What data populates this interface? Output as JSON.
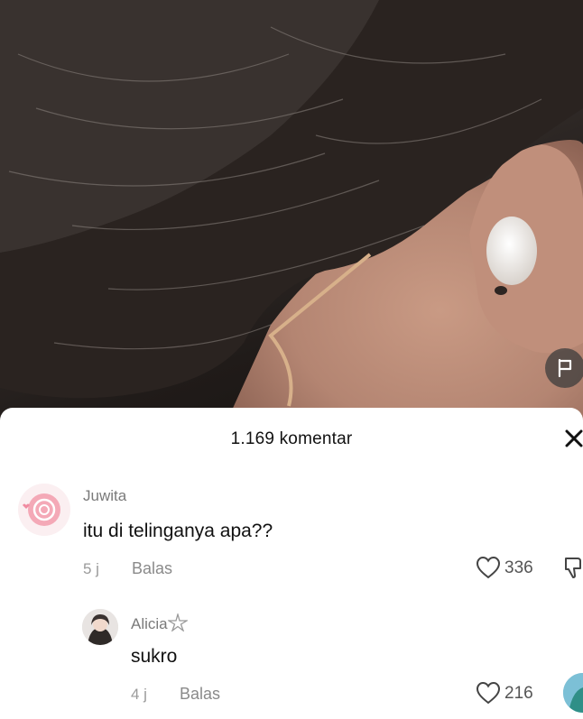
{
  "comments_header": {
    "count_label": "1.169 komentar"
  },
  "comments": [
    {
      "user": "Juwita",
      "text": "itu di telinganya apa??",
      "time": "5 j",
      "reply_label": "Balas",
      "likes": "336"
    },
    {
      "user": "Alicia",
      "text": "sukro",
      "time": "4 j",
      "reply_label": "Balas",
      "likes": "216"
    }
  ],
  "icons": [
    "flag-icon",
    "close-icon",
    "heart-icon",
    "dislike-icon",
    "star-icon"
  ],
  "colors": {
    "sheet": "#ffffff",
    "text": "#111111",
    "muted": "#8a8a8a",
    "avatar_pink": "#f4a9b7"
  }
}
